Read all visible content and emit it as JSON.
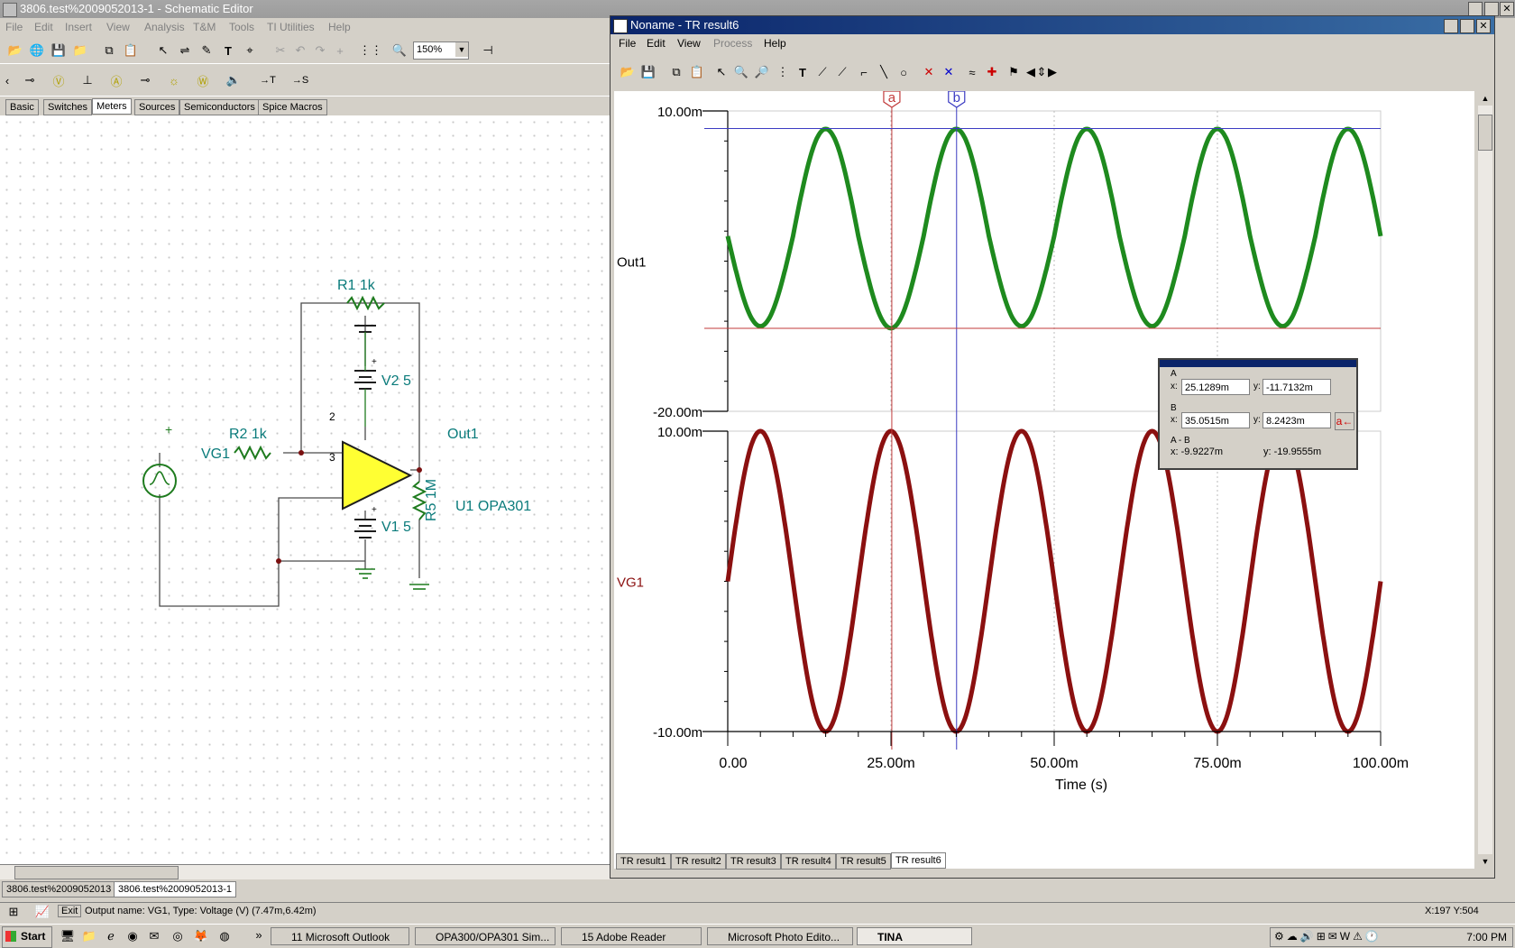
{
  "schematic_window": {
    "title": "3806.test%2009052013-1 - Schematic Editor",
    "menu": [
      "File",
      "Edit",
      "Insert",
      "View",
      "Analysis",
      "T&M",
      "Tools",
      "TI Utilities",
      "Help"
    ],
    "zoom": "150%",
    "component_tabs": [
      "Basic",
      "Switches",
      "Meters",
      "Sources",
      "Semiconductors",
      "Spice Macros"
    ],
    "active_tab": "Meters",
    "doc_tabs": [
      "3806.test%2009052013",
      "3806.test%2009052013-1"
    ],
    "labels": {
      "r1": "R1 1k",
      "r2": "R2 1k",
      "v2": "V2 5",
      "v1": "V1 5",
      "r5": "R5 1M",
      "out": "Out1",
      "vg": "VG1",
      "u1": "U1 OPA301",
      "pin2": "2",
      "pin3": "3",
      "plus": "+",
      "minus": "-",
      "plus2": "+",
      "minus2": "-"
    }
  },
  "result_window": {
    "title": "Noname - TR result6",
    "menu": [
      "File",
      "Edit",
      "View",
      "Process",
      "Help"
    ],
    "bottom_tabs": [
      "TR result1",
      "TR result2",
      "TR result3",
      "TR result4",
      "TR result5",
      "TR result6"
    ],
    "active_tab": "TR result6",
    "cursor_a": "a",
    "cursor_b": "b"
  },
  "cursor_panel": {
    "a_label": "A",
    "b_label": "B",
    "ab_label": "A - B",
    "a_x": "25.1289m",
    "a_y": "-11.7132m",
    "b_x": "35.0515m",
    "b_y": "8.2423m",
    "ab_x": "x:  -9.9227m",
    "ab_y": "y: -19.9555m",
    "x_lbl": "x:",
    "y_lbl": "y:"
  },
  "chart_data": [
    {
      "type": "line",
      "title": "",
      "ylabel": "Out1",
      "xlabel": "Time (s)",
      "xlim": [
        0,
        100
      ],
      "ylim": [
        -20,
        10
      ],
      "ytick_labels": [
        "10.00m",
        "-20.00m"
      ],
      "x_unit": "ms",
      "series": [
        {
          "name": "Out1",
          "color": "#1e8a1e",
          "x": [
            0,
            5,
            10,
            15,
            20,
            25,
            30,
            35,
            40,
            45,
            50,
            55,
            60,
            65,
            70,
            75,
            80,
            85,
            90,
            95,
            100
          ],
          "values": [
            -2.5,
            -11.5,
            -2.5,
            8.2,
            -2.5,
            -11.7,
            -2.5,
            8.2,
            -2.5,
            -11.5,
            -2.5,
            8.2,
            -2.5,
            -11.5,
            -2.5,
            8.2,
            -2.5,
            -11.5,
            -2.5,
            8.2,
            -2.5
          ]
        }
      ]
    },
    {
      "type": "line",
      "title": "",
      "ylabel": "VG1",
      "xlabel": "Time (s)",
      "xlim": [
        0,
        100
      ],
      "ylim": [
        -10,
        10
      ],
      "ytick_labels": [
        "10.00m",
        "-10.00m"
      ],
      "xtick_labels": [
        "0.00",
        "25.00m",
        "50.00m",
        "75.00m",
        "100.00m"
      ],
      "series": [
        {
          "name": "VG1",
          "color": "#8b1010",
          "x": [
            0,
            5,
            10,
            15,
            20,
            25,
            30,
            35,
            40,
            45,
            50,
            55,
            60,
            65,
            70,
            75,
            80,
            85,
            90,
            95,
            100
          ],
          "values": [
            0,
            10,
            0,
            -10,
            0,
            10,
            0,
            -10,
            0,
            10,
            0,
            -10,
            0,
            10,
            0,
            -10,
            0,
            10,
            0,
            -10,
            0
          ]
        }
      ]
    }
  ],
  "status": {
    "output_text": "Output name: VG1, Type: Voltage (V) (7.47m,6.42m)",
    "coords": "X:197  Y:504",
    "exit": "Exit"
  },
  "taskbar": {
    "start": "Start",
    "tasks": [
      "11 Microsoft Outlook",
      "OPA300/OPA301 Sim...",
      "15 Adobe Reader",
      "Microsoft Photo Edito...",
      "TINA"
    ],
    "time": "7:00 PM"
  }
}
